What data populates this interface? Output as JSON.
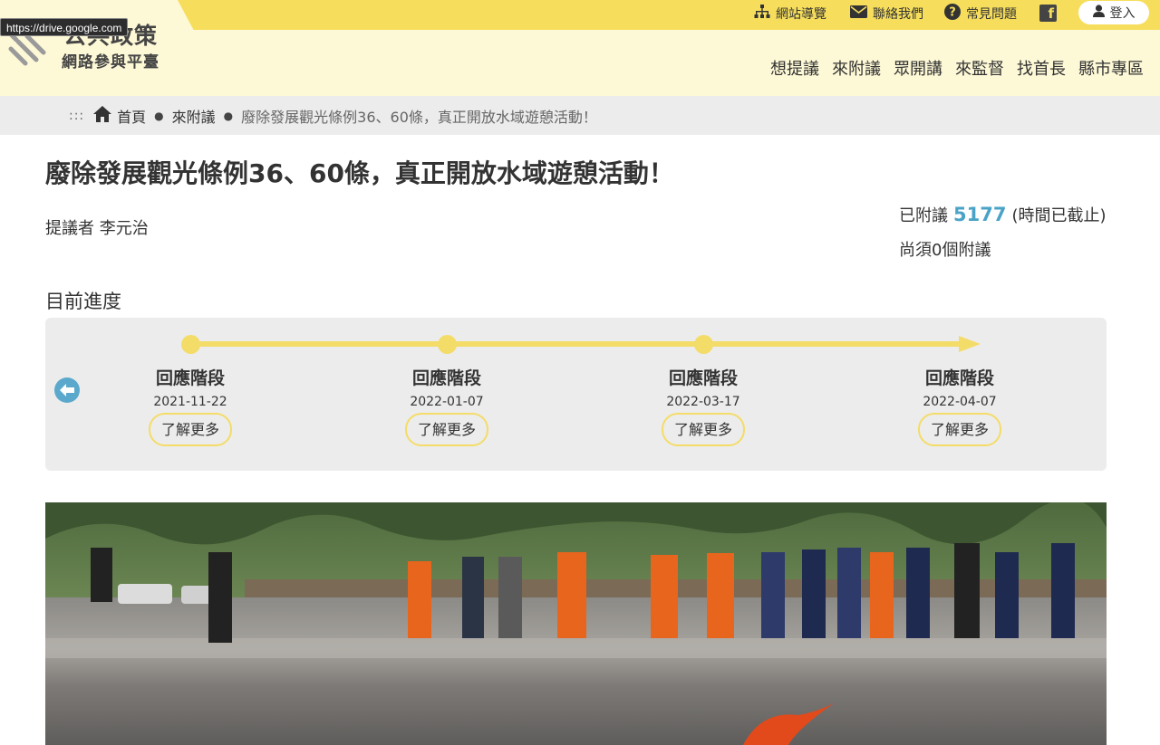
{
  "header": {
    "logo_title": "公共政策",
    "logo_subtitle": "網路參與平臺",
    "url_tooltip": "https://drive.google.com",
    "utility": [
      {
        "label": "網站導覽",
        "icon": "sitemap-icon"
      },
      {
        "label": "聯絡我們",
        "icon": "mail-icon"
      },
      {
        "label": "常見問題",
        "icon": "question-icon"
      }
    ],
    "facebook_icon": "facebook-icon",
    "login_label": "登入",
    "nav": [
      "想提議",
      "來附議",
      "眾開講",
      "來監督",
      "找首長",
      "縣市專區"
    ]
  },
  "breadcrumb": {
    "dots": ":::",
    "home": "首頁",
    "section": "來附議",
    "current": "廢除發展觀光條例36、60條，真正開放水域遊憩活動！"
  },
  "proposal": {
    "title": "廢除發展觀光條例36、60條，真正開放水域遊憩活動！",
    "proposer": "提議者 李元治",
    "endorsed_prefix": "已附議",
    "endorsed_count": "5177",
    "endorsed_status": "(時間已截止)",
    "remaining": "尚須0個附議"
  },
  "progress": {
    "heading": "目前進度",
    "stages": [
      {
        "label": "回應階段",
        "date": "2021-11-22",
        "more": "了解更多"
      },
      {
        "label": "回應階段",
        "date": "2022-01-07",
        "more": "了解更多"
      },
      {
        "label": "回應階段",
        "date": "2022-03-17",
        "more": "了解更多"
      },
      {
        "label": "回應階段",
        "date": "2022-04-07",
        "more": "了解更多"
      }
    ]
  },
  "colors": {
    "accent_yellow": "#f6de5c",
    "header_bg": "#fdf8d6",
    "count_blue": "#4aa3c7"
  }
}
